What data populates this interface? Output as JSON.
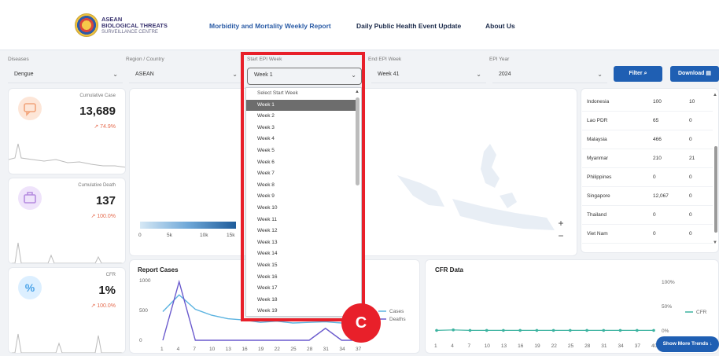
{
  "header": {
    "logo": {
      "line1": "ASEAN",
      "line2": "BIOLOGICAL THREATS",
      "line3": "SURVEILLANCE CENTRE"
    },
    "nav": [
      {
        "label": "Morbidity and Mortality Weekly Report",
        "active": true
      },
      {
        "label": "Daily Public Health Event Update",
        "active": false
      },
      {
        "label": "About Us",
        "active": false
      }
    ]
  },
  "filters": {
    "diseases": {
      "label": "Diseases",
      "value": "Dengue"
    },
    "region": {
      "label": "Region / Country",
      "value": "ASEAN"
    },
    "start_week": {
      "label": "Start EPI Week",
      "value": "Week 1"
    },
    "end_week": {
      "label": "End EPI Week",
      "value": "Week 41"
    },
    "year": {
      "label": "EPI Year",
      "value": "2024"
    },
    "filter_button": "Filter",
    "download_button": "Download"
  },
  "summary": {
    "cases": {
      "label": "Cumulative Case",
      "value": "13,689",
      "delta": "↗ 74.9%",
      "icon": "chat-icon",
      "color": "#f2a47b"
    },
    "deaths": {
      "label": "Cumulative Death",
      "value": "137",
      "delta": "↗ 100.0%",
      "icon": "briefcase-icon",
      "color": "#b58be0"
    },
    "cfr": {
      "label": "CFR",
      "value": "1%",
      "delta": "↗ 100.0%",
      "icon": "percent-icon",
      "color": "#4aa3e8"
    }
  },
  "map": {
    "legend_ticks": [
      "0",
      "5k",
      "10k",
      "15k"
    ],
    "zoom_in": "+",
    "zoom_out": "−"
  },
  "country_table": [
    {
      "country": "Indonesia",
      "cases": "100",
      "deaths": "10"
    },
    {
      "country": "Lao PDR",
      "cases": "65",
      "deaths": "0"
    },
    {
      "country": "Malaysia",
      "cases": "466",
      "deaths": "0"
    },
    {
      "country": "Myanmar",
      "cases": "210",
      "deaths": "21"
    },
    {
      "country": "Philippines",
      "cases": "0",
      "deaths": "0"
    },
    {
      "country": "Singapore",
      "cases": "12,067",
      "deaths": "0"
    },
    {
      "country": "Thailand",
      "cases": "0",
      "deaths": "0"
    },
    {
      "country": "Viet Nam",
      "cases": "0",
      "deaths": "0"
    }
  ],
  "dropdown": {
    "placeholder": "Select Start Week",
    "options": [
      "Week 1",
      "Week 2",
      "Week 3",
      "Week 4",
      "Week 5",
      "Week 6",
      "Week 7",
      "Week 8",
      "Week 9",
      "Week 10",
      "Week 11",
      "Week 12",
      "Week 13",
      "Week 14",
      "Week 15",
      "Week 16",
      "Week 17",
      "Week 18",
      "Week 19"
    ],
    "selected": "Week 1"
  },
  "annotation": {
    "badge": "C"
  },
  "show_more": "Show More Trends ↓",
  "chart_data": [
    {
      "type": "line",
      "title": "Report Cases",
      "x": [
        1,
        4,
        7,
        10,
        13,
        16,
        19,
        22,
        25,
        28,
        31,
        34,
        37
      ],
      "ylim": [
        0,
        1000
      ],
      "yticks": [
        "0",
        "500",
        "1000"
      ],
      "series": [
        {
          "name": "Cases",
          "color": "#5bb3e0",
          "values": [
            480,
            760,
            520,
            420,
            360,
            340,
            300,
            320,
            290,
            300,
            310,
            290,
            300
          ]
        },
        {
          "name": "Deaths",
          "color": "#6a5acd",
          "values": [
            0,
            980,
            0,
            0,
            0,
            0,
            0,
            0,
            0,
            0,
            200,
            0,
            0
          ]
        }
      ]
    },
    {
      "type": "line",
      "title": "CFR Data",
      "x": [
        1,
        4,
        7,
        10,
        13,
        16,
        19,
        22,
        25,
        28,
        31,
        34,
        37,
        40
      ],
      "yticks": [
        "0%",
        "50%",
        "100%"
      ],
      "series": [
        {
          "name": "CFR",
          "color": "#3cb3a0",
          "values": [
            1,
            2,
            1,
            1,
            1,
            1,
            1,
            1,
            1,
            1,
            1,
            1,
            1,
            1
          ]
        }
      ]
    }
  ]
}
